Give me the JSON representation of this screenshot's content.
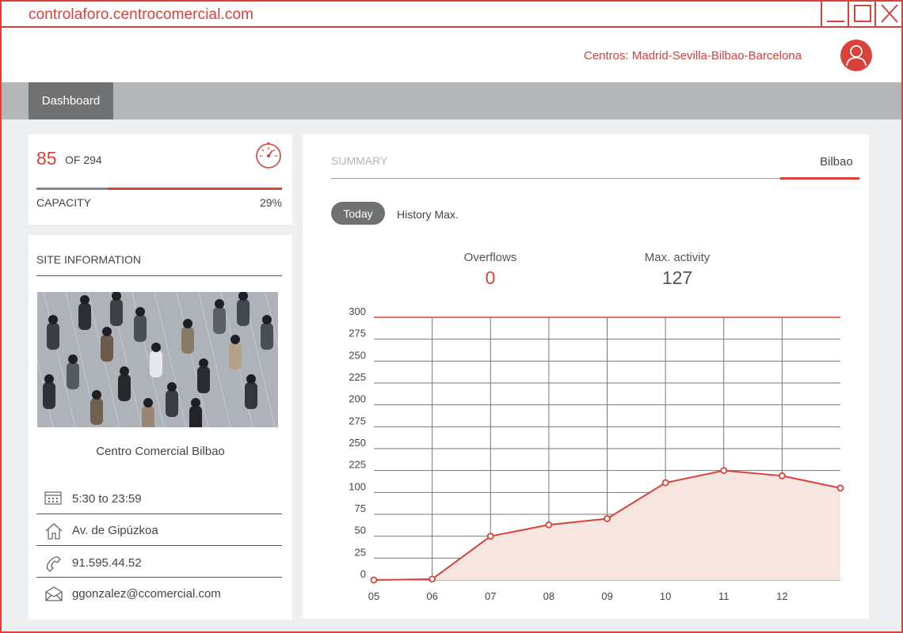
{
  "window": {
    "url": "controlaforo.centrocomercial.com"
  },
  "header": {
    "centros": "Centros: Madrid-Sevilla-Bilbao-Barcelona"
  },
  "nav": {
    "tab": "Dashboard"
  },
  "capacity": {
    "current": "85",
    "of": "OF 294",
    "label": "CAPACITY",
    "percent": "29%",
    "fill_fraction": 0.29
  },
  "site": {
    "title": "SITE INFORMATION",
    "name": "Centro Comercial Bilbao",
    "hours": "5:30 to 23:59",
    "address": "Av. de Gipúzkoa",
    "phone": "91.595.44.52",
    "email": "ggonzalez@ccomercial.com"
  },
  "summary": {
    "title": "SUMMARY",
    "location_tab": "Bilbao",
    "today_button": "Today",
    "history_button": "History Max.",
    "overflows_label": "Overflows",
    "overflows_value": "0",
    "max_label": "Max. activity",
    "max_value": "127"
  },
  "colors": {
    "accent": "#d9413a",
    "dark_gray": "#707173",
    "fill": "#f7e5df"
  },
  "chart_data": {
    "type": "area",
    "x": [
      "05",
      "06",
      "07",
      "08",
      "09",
      "10",
      "11",
      "12",
      ""
    ],
    "values": [
      0,
      1,
      50,
      63,
      70,
      111,
      125,
      119,
      105
    ],
    "y_tick_labels": [
      "0",
      "25",
      "50",
      "75",
      "100",
      "225",
      "250",
      "275",
      "200",
      "225",
      "250",
      "275",
      "300"
    ],
    "ylim": [
      0,
      300
    ],
    "threshold": 300,
    "grid": true
  }
}
